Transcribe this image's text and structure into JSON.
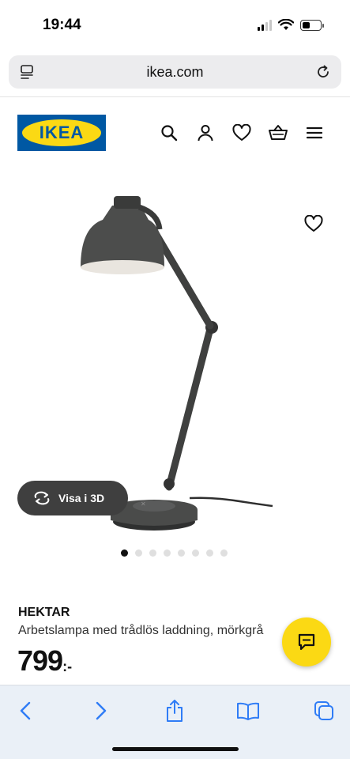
{
  "status_bar": {
    "time": "19:44"
  },
  "browser": {
    "url": "ikea.com"
  },
  "brand": {
    "logo_text": "IKEA",
    "blue": "#0058a3",
    "yellow": "#fbd914"
  },
  "header": {
    "icons": [
      "search-icon",
      "account-icon",
      "heart-icon",
      "basket-icon",
      "menu-icon"
    ]
  },
  "gallery": {
    "view_3d_label": "Visa i 3D",
    "image_count": 8,
    "active_index": 0
  },
  "product": {
    "name": "HEKTAR",
    "description": "Arbetslampa med trådlös laddning, mörkgrå",
    "price": "799",
    "price_suffix": ":-"
  },
  "toolbar": {
    "icons": [
      "back-icon",
      "forward-icon",
      "share-icon",
      "bookmarks-icon",
      "tabs-icon"
    ]
  }
}
